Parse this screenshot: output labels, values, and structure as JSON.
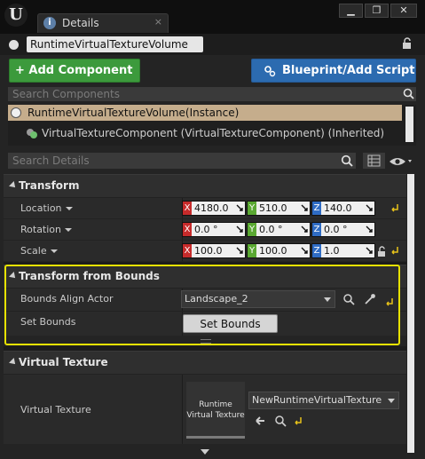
{
  "window": {
    "logo_letter": "U",
    "tab_icon_letter": "i",
    "tab_title": "Details",
    "tab_close": "×",
    "buttons": [
      "▁",
      "❐",
      "✕"
    ]
  },
  "actor": {
    "name": "RuntimeVirtualTextureVolume"
  },
  "toolbar": {
    "add_component_label": "+ Add Component",
    "blueprint_label": "Blueprint/Add Script"
  },
  "components": {
    "search_placeholder": "Search Components",
    "instance_label": "RuntimeVirtualTextureVolume(Instance)",
    "child_label": "VirtualTextureComponent (VirtualTextureComponent) (Inherited)"
  },
  "details": {
    "search_placeholder": "Search Details"
  },
  "transform": {
    "header": "Transform",
    "location_label": "Location",
    "rotation_label": "Rotation",
    "scale_label": "Scale",
    "axis_labels": [
      "X",
      "Y",
      "Z"
    ],
    "location": [
      "4180.0",
      "510.0",
      "140.0"
    ],
    "rotation": [
      "0.0 °",
      "0.0 °",
      "0.0 °"
    ],
    "scale": [
      "100.0",
      "100.0",
      "1.0"
    ]
  },
  "transform_from_bounds": {
    "header": "Transform from Bounds",
    "bounds_align_actor_label": "Bounds Align Actor",
    "bounds_align_actor_value": "Landscape_2",
    "set_bounds_label": "Set Bounds",
    "set_bounds_button": "Set Bounds"
  },
  "virtual_texture": {
    "header": "Virtual Texture",
    "label": "Virtual Texture",
    "thumbnail_line1": "Runtime",
    "thumbnail_line2": "Virtual Texture",
    "asset_value": "NewRuntimeVirtualTexture"
  },
  "colors": {
    "add_button": "#3c9a3c",
    "blueprint_button": "#2c6bb0",
    "selection": "#c5ad8c",
    "highlight_border": "#e7e200",
    "axis_x": "#c62b2b",
    "axis_y": "#5aa832",
    "axis_z": "#2f6cc4",
    "reset_arrow": "#e7c21a"
  }
}
